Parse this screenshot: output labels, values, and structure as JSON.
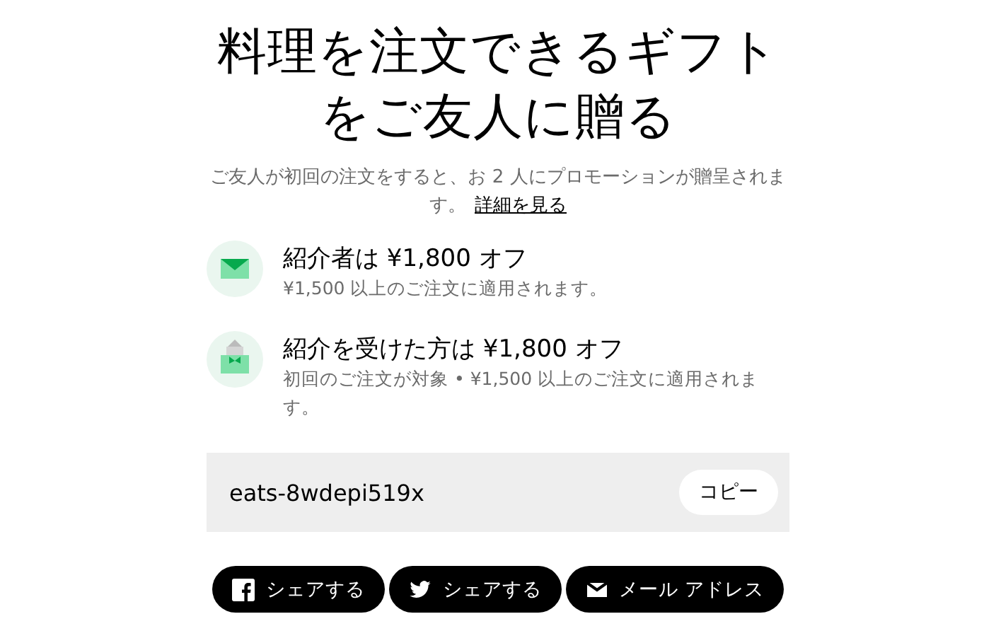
{
  "title": [
    "料理を注文できるギフト",
    "をご友人に贈る"
  ],
  "description": {
    "text": "ご友人が初回の注文をすると、お 2 人にプロモーションが贈呈されます。",
    "link": "詳細を見る"
  },
  "benefits": [
    {
      "kind": "mail",
      "heading": "紹介者は ¥1,800 オフ",
      "detail": "¥1,500 以上のご注文に適用されます。"
    },
    {
      "kind": "gift",
      "heading": "紹介を受けた方は ¥1,800 オフ",
      "detail": "初回のご注文が対象 • ¥1,500 以上のご注文に適用されます。"
    }
  ],
  "code": {
    "value": "eats-8wdepi519x",
    "button": "コピー"
  },
  "share_buttons": [
    {
      "kind": "facebook",
      "label": "シェアする"
    },
    {
      "kind": "twitter",
      "label": "シェアする"
    },
    {
      "kind": "email",
      "label": "メール アドレス"
    }
  ]
}
